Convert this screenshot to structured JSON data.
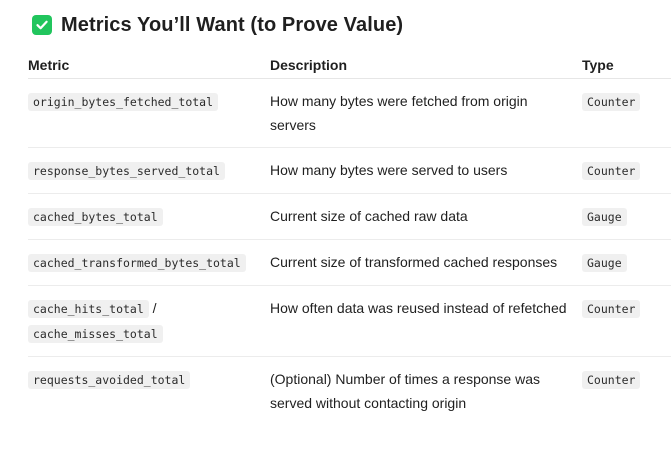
{
  "heading": {
    "icon": "check-box-icon",
    "accent_color": "#21c55d",
    "title": "Metrics You’ll Want (to Prove Value)"
  },
  "table": {
    "headers": {
      "metric": "Metric",
      "description": "Description",
      "type": "Type"
    },
    "rows": [
      {
        "metric": "origin_bytes_fetched_total",
        "description": "How many bytes were fetched from origin servers",
        "type": "Counter"
      },
      {
        "metric": "response_bytes_served_total",
        "description": "How many bytes were served to users",
        "type": "Counter"
      },
      {
        "metric": "cached_bytes_total",
        "description": "Current size of cached raw data",
        "type": "Gauge"
      },
      {
        "metric": "cached_transformed_bytes_total",
        "description": "Current size of transformed cached responses",
        "type": "Gauge"
      },
      {
        "metric": "cache_hits_total",
        "metric_separator": " /",
        "metric_2": "cache_misses_total",
        "description": "How often data was reused instead of refetched",
        "type": "Counter"
      },
      {
        "metric": "requests_avoided_total",
        "description": "(Optional) Number of times a response was served without contacting origin",
        "type": "Counter"
      }
    ]
  }
}
